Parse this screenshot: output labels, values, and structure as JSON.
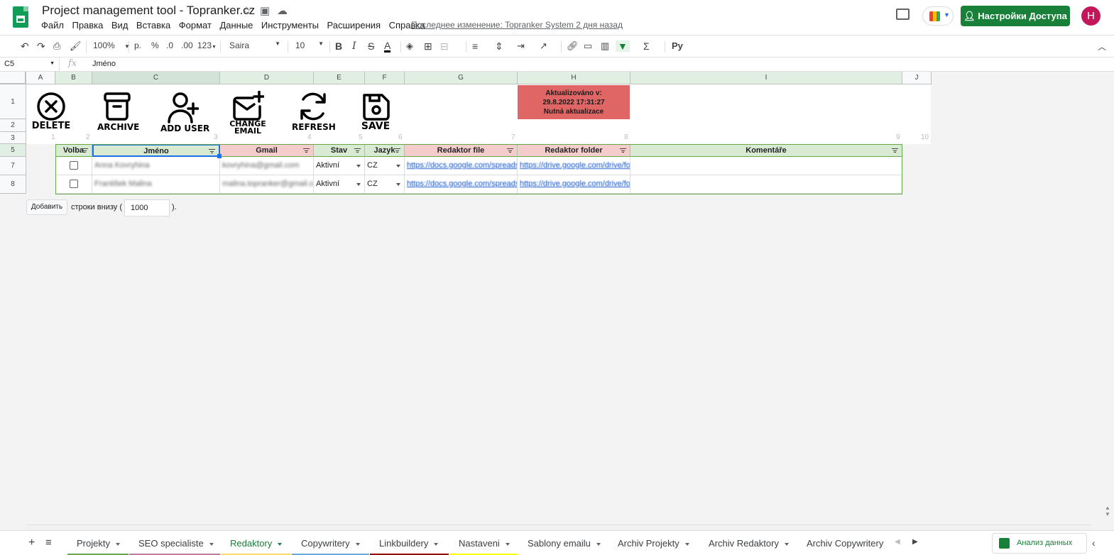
{
  "doc": {
    "title": "Project management tool - Topranker.cz",
    "menu": [
      "Файл",
      "Правка",
      "Вид",
      "Вставка",
      "Формат",
      "Данные",
      "Инструменты",
      "Расширения",
      "Справка"
    ],
    "last_edit": "Последнее изменение: Topranker System 2 дня назад",
    "share_label": "Настройки Доступа",
    "avatar_letter": "H"
  },
  "toolbar": {
    "zoom": "100%",
    "currency": "р.",
    "percent": "%",
    "dec_less": ".0",
    "dec_more": ".00",
    "num_format": "123",
    "font": "Saira",
    "font_size": "10",
    "bold": "B",
    "italic": "I",
    "strike": "S",
    "text_color": "A",
    "sigma": "Σ",
    "input_tools": "Py"
  },
  "formula": {
    "cell_ref": "C5",
    "fx": "fx",
    "value": "Jméno"
  },
  "columns": [
    "A",
    "B",
    "C",
    "D",
    "E",
    "F",
    "G",
    "H",
    "I",
    "J"
  ],
  "rows": [
    "1",
    "2",
    "3",
    "5",
    "7",
    "8"
  ],
  "row_numbers": [
    "1",
    "2",
    "3",
    "4",
    "5",
    "6",
    "7",
    "8",
    "9",
    "10"
  ],
  "actions": [
    {
      "label": "DELETE",
      "icon": "delete-circle-icon"
    },
    {
      "label": "ARCHIVE",
      "icon": "archive-box-icon"
    },
    {
      "label": "ADD USER",
      "icon": "add-user-icon"
    },
    {
      "label": "CHANGE EMAIL",
      "line1": "CHANGE",
      "line2": "EMAIL",
      "icon": "mail-plus-icon"
    },
    {
      "label": "REFRESH",
      "icon": "refresh-icon"
    },
    {
      "label": "SAVE",
      "icon": "save-icon"
    }
  ],
  "status": {
    "line1": "Aktualizováno v:",
    "line2": "29.8.2022 17:31:27",
    "line3": "Nutná aktualizace",
    "color": "#e06666"
  },
  "table": {
    "headers": [
      "Volba",
      "Jméno",
      "Gmail",
      "Stav",
      "Jazyk",
      "Redaktor file",
      "Redaktor folder",
      "Komentáře"
    ],
    "rows": [
      {
        "jmeno": "Anna Kovryhina",
        "gmail": "kovryhina@gmail.com",
        "stav": "Aktivní",
        "jazyk": "CZ",
        "file": "https://docs.google.com/spreadsheets",
        "folder": "https://drive.google.com/drive/folders"
      },
      {
        "jmeno": "František Malina",
        "gmail": "malina.topranker@gmail.com",
        "stav": "Aktivní",
        "jazyk": "CZ",
        "file": "https://docs.google.com/spreadsheets",
        "folder": "https://drive.google.com/drive/folders"
      }
    ]
  },
  "add_rows": {
    "button": "Добавить",
    "text": "строки внизу (",
    "value": "1000",
    "end": ")."
  },
  "sheets": [
    {
      "label": "Projekty",
      "color": "#6aa84f"
    },
    {
      "label": "SEO specialiste",
      "color": "#c27ba0"
    },
    {
      "label": "Redaktory",
      "color": "#ffd966"
    },
    {
      "label": "Copywritery",
      "color": "#6fa8dc"
    },
    {
      "label": "Linkbuildery",
      "color": "#990000"
    },
    {
      "label": "Nastaveni",
      "color": "#ffff00"
    },
    {
      "label": "Sablony emailu",
      "color": ""
    },
    {
      "label": "Archiv Projekty",
      "color": ""
    },
    {
      "label": "Archiv Redaktory",
      "color": ""
    },
    {
      "label": "Archiv Copywritery",
      "color": ""
    }
  ],
  "explore_label": "Анализ данных",
  "colors": {
    "brand_green": "#188038",
    "header_green": "#d9ead3",
    "header_pink": "#f4cccc"
  }
}
